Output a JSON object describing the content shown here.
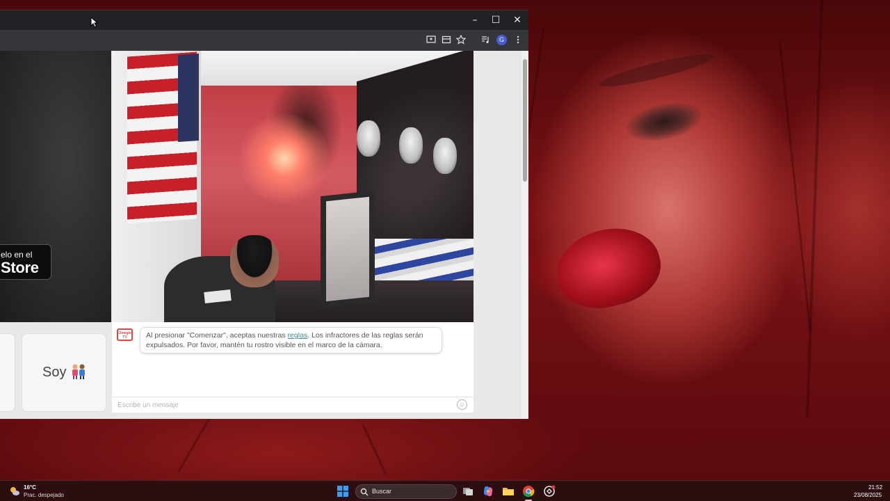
{
  "browser": {
    "window_controls": {
      "minimize": "–",
      "maximize": "☐",
      "close": "✕"
    },
    "toolbar_icons": [
      "cast-icon",
      "reading-mode-icon",
      "bookmark-star-icon",
      "media-controls-icon",
      "profile-avatar",
      "menu-kebab-icon"
    ],
    "profile_initial": "G"
  },
  "page": {
    "store_badge": {
      "small_text": "elo en el",
      "big_text": "Store"
    },
    "choice_card_label": "Soy",
    "chat": {
      "logo_text": "Omegle TV",
      "notice_before_link": "Al presionar \"Comenzar\", aceptas nuestras ",
      "notice_link": "reglas",
      "notice_after_link": ". Los infractores de las reglas serán expulsados. Por favor, mantén tu rostro visible en el marco de la cámara.",
      "input_placeholder": "Escribe un mensaje"
    }
  },
  "taskbar": {
    "weather": {
      "temperature": "16°C",
      "condition": "Prac. despejado"
    },
    "search_placeholder": "Buscar",
    "apps": [
      "task-view-icon",
      "copilot-icon",
      "file-explorer-icon",
      "chrome-icon",
      "chatgpt-icon"
    ],
    "clock": {
      "time": "21:52",
      "date": "23/08/2025"
    }
  },
  "colors": {
    "chrome_titlebar": "#202124",
    "chrome_toolbar": "#35363a",
    "rules_link": "#3f8a8f",
    "wallpaper_red": "#b13a36"
  }
}
